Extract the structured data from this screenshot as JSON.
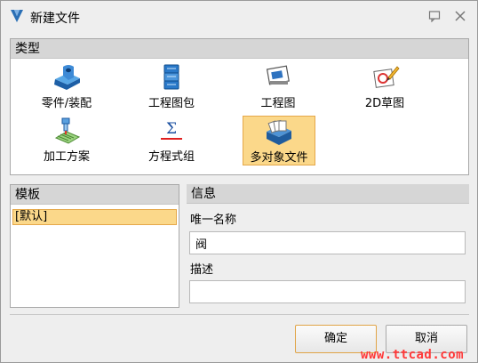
{
  "window": {
    "title": "新建文件"
  },
  "type_section": {
    "header": "类型",
    "items": [
      {
        "label": "零件/装配",
        "icon": "part-assembly-icon"
      },
      {
        "label": "工程图包",
        "icon": "drawing-package-icon"
      },
      {
        "label": "工程图",
        "icon": "drawing-icon"
      },
      {
        "label": "2D草图",
        "icon": "sketch-2d-icon"
      },
      {
        "label": "加工方案",
        "icon": "machining-plan-icon"
      },
      {
        "label": "方程式组",
        "icon": "equation-set-icon",
        "glyph": "Σ"
      },
      {
        "label": "多对象文件",
        "icon": "multi-object-file-icon",
        "selected": true
      }
    ]
  },
  "template_section": {
    "header": "模板",
    "items": [
      {
        "label": "[默认]",
        "selected": true
      }
    ]
  },
  "info_section": {
    "header": "信息",
    "name_label": "唯一名称",
    "name_value": "阀",
    "desc_label": "描述",
    "desc_value": ""
  },
  "buttons": {
    "ok": "确定",
    "cancel": "取消"
  },
  "watermark": "www.ttcad.com",
  "colors": {
    "selection_bg": "#fbd88a",
    "selection_border": "#e5a84a",
    "watermark": "#ff3838"
  }
}
